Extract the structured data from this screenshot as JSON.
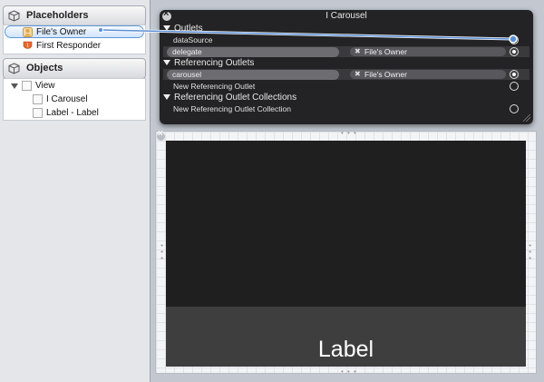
{
  "outline": {
    "placeholders": {
      "title": "Placeholders",
      "items": [
        {
          "label": "File's Owner",
          "icon": "files-owner-icon"
        },
        {
          "label": "First Responder",
          "icon": "first-responder-icon"
        }
      ]
    },
    "objects": {
      "title": "Objects",
      "tree": {
        "label": "View",
        "children": [
          {
            "label": "I Carousel"
          },
          {
            "label": "Label - Label"
          }
        ]
      }
    }
  },
  "hud": {
    "title": "I Carousel",
    "outlets": {
      "title": "Outlets",
      "rows": [
        {
          "name": "dataSource",
          "target": "",
          "connected": true
        },
        {
          "name": "delegate",
          "target": "File's Owner",
          "connected": true
        }
      ]
    },
    "referencing_outlets": {
      "title": "Referencing Outlets",
      "rows": [
        {
          "name": "carousel",
          "target": "File's Owner",
          "connected": true
        },
        {
          "name": "New Referencing Outlet",
          "target": "",
          "connected": false
        }
      ]
    },
    "referencing_outlet_collections": {
      "title": "Referencing Outlet Collections",
      "rows": [
        {
          "name": "New Referencing Outlet Collection",
          "target": "",
          "connected": false
        }
      ]
    }
  },
  "view": {
    "label_text": "Label"
  },
  "colors": {
    "hud_bg": "#1c1c1e",
    "carousel_bg": "#1f1f1f",
    "label_bg": "#3e3e3e",
    "selection": "#5e98d8",
    "connection_line": "#5b8fd6"
  }
}
